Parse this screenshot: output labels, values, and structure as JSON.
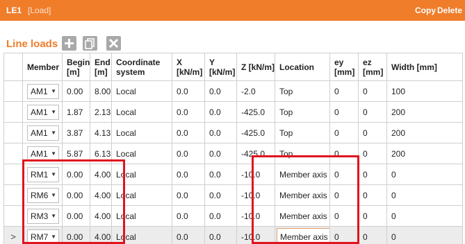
{
  "header": {
    "id": "LE1",
    "type": "[Load]",
    "copy_label": "Copy",
    "delete_label": "Delete"
  },
  "section": {
    "title": "Line loads"
  },
  "columns": [
    {
      "key": "arrow",
      "label": ""
    },
    {
      "key": "member",
      "label": "Member"
    },
    {
      "key": "begin",
      "label": "Begin [m]"
    },
    {
      "key": "end",
      "label": "End [m]"
    },
    {
      "key": "coord",
      "label": "Coordinate system"
    },
    {
      "key": "x",
      "label": "X [kN/m]"
    },
    {
      "key": "y",
      "label": "Y [kN/m]"
    },
    {
      "key": "z",
      "label": "Z [kN/m]"
    },
    {
      "key": "location",
      "label": "Location"
    },
    {
      "key": "ey",
      "label": "ey [mm]"
    },
    {
      "key": "ez",
      "label": "ez [mm]"
    },
    {
      "key": "width",
      "label": "Width [mm]"
    }
  ],
  "rows": [
    {
      "arrow": "",
      "member": "AM1",
      "begin": "0.00",
      "end": "8.00",
      "coord": "Local",
      "x": "0.0",
      "y": "0.0",
      "z": "-2.0",
      "location": "Top",
      "ey": "0",
      "ez": "0",
      "width": "100"
    },
    {
      "arrow": "",
      "member": "AM1",
      "begin": "1.87",
      "end": "2.13",
      "coord": "Local",
      "x": "0.0",
      "y": "0.0",
      "z": "-425.0",
      "location": "Top",
      "ey": "0",
      "ez": "0",
      "width": "200"
    },
    {
      "arrow": "",
      "member": "AM1",
      "begin": "3.87",
      "end": "4.13",
      "coord": "Local",
      "x": "0.0",
      "y": "0.0",
      "z": "-425.0",
      "location": "Top",
      "ey": "0",
      "ez": "0",
      "width": "200"
    },
    {
      "arrow": "",
      "member": "AM1",
      "begin": "5.87",
      "end": "6.13",
      "coord": "Local",
      "x": "0.0",
      "y": "0.0",
      "z": "-425.0",
      "location": "Top",
      "ey": "0",
      "ez": "0",
      "width": "200"
    },
    {
      "arrow": "",
      "member": "RM1",
      "begin": "0.00",
      "end": "4.00",
      "coord": "Local",
      "x": "0.0",
      "y": "0.0",
      "z": "-10.0",
      "location": "Member axis",
      "ey": "0",
      "ez": "0",
      "width": "0"
    },
    {
      "arrow": "",
      "member": "RM6",
      "begin": "0.00",
      "end": "4.00",
      "coord": "Local",
      "x": "0.0",
      "y": "0.0",
      "z": "-10.0",
      "location": "Member axis",
      "ey": "0",
      "ez": "0",
      "width": "0"
    },
    {
      "arrow": "",
      "member": "RM3",
      "begin": "0.00",
      "end": "4.00",
      "coord": "Local",
      "x": "0.0",
      "y": "0.0",
      "z": "-10.0",
      "location": "Member axis",
      "ey": "0",
      "ez": "0",
      "width": "0"
    },
    {
      "arrow": ">",
      "member": "RM7",
      "begin": "0.00",
      "end": "4.00",
      "coord": "Local",
      "x": "0.0",
      "y": "0.0",
      "z": "-10.0",
      "location": "Member axis",
      "ey": "0",
      "ez": "0",
      "width": "0"
    }
  ],
  "selected_row": 7,
  "colors": {
    "accent": "#ef7d2a",
    "highlight": "#e0141e",
    "button_gray": "#a9a9a9"
  },
  "icons": {
    "add": "plus-icon",
    "copy": "copy-icon",
    "delete": "x-icon",
    "dropdown": "chevron-down-icon",
    "row_pointer": "chevron-right-icon"
  }
}
